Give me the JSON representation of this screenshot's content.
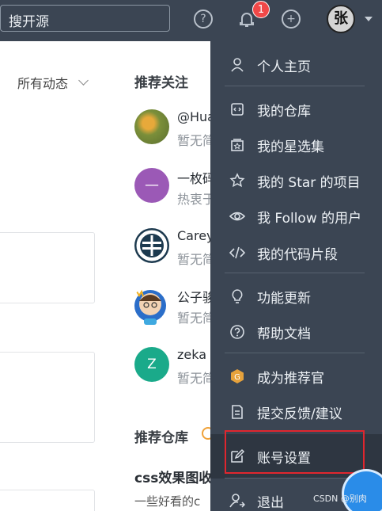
{
  "topbar": {
    "search_placeholder": "搜开源",
    "help_icon": "?",
    "plus_icon": "+",
    "notification_count": "1",
    "avatar_text": "张"
  },
  "feed": {
    "filter_label": "所有动态"
  },
  "recommend": {
    "title": "推荐关注",
    "users": [
      {
        "name": "@Hua",
        "desc": "暂无简"
      },
      {
        "name": "一枚码",
        "desc": "热衷于"
      },
      {
        "name": "Carey",
        "desc": "暂无简"
      },
      {
        "name": "公子骏",
        "desc": "暂无简"
      },
      {
        "name": "zeka",
        "desc": "暂无简"
      }
    ],
    "user_initials": [
      "—",
      "Z"
    ],
    "repo_title": "推荐仓库",
    "repo_name": "css效果图收",
    "repo_desc": "一些好看的c"
  },
  "menu": {
    "items": [
      {
        "label": "个人主页",
        "icon": "user-icon"
      },
      {
        "label": "我的仓库",
        "icon": "repo-icon"
      },
      {
        "label": "我的星选集",
        "icon": "collection-icon"
      },
      {
        "label": "我的 Star 的项目",
        "icon": "star-icon"
      },
      {
        "label": "我 Follow 的用户",
        "icon": "eye-icon"
      },
      {
        "label": "我的代码片段",
        "icon": "code-icon"
      },
      {
        "label": "功能更新",
        "icon": "bulb-icon"
      },
      {
        "label": "帮助文档",
        "icon": "help-icon"
      },
      {
        "label": "成为推荐官",
        "icon": "recommend-badge-icon"
      },
      {
        "label": "提交反馈/建议",
        "icon": "feedback-icon"
      },
      {
        "label": "账号设置",
        "icon": "edit-icon"
      },
      {
        "label": "退出",
        "icon": "logout-icon"
      }
    ]
  },
  "watermark": "CSDN @别肉",
  "colors": {
    "topbar": "#3b4553",
    "menu_bg": "#3b4553",
    "highlight_border": "#e0262e",
    "badge": "#f04848"
  }
}
